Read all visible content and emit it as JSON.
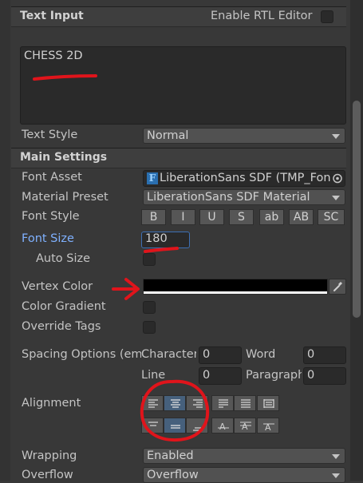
{
  "text_input": {
    "header": "Text Input",
    "rtl_label": "Enable RTL Editor",
    "text_value": "CHESS 2D",
    "text_style_label": "Text Style",
    "text_style_value": "Normal"
  },
  "main_settings": {
    "header": "Main Settings",
    "font_asset_label": "Font Asset",
    "font_asset_value": "LiberationSans SDF (TMP_Fon",
    "material_preset_label": "Material Preset",
    "material_preset_value": "LiberationSans SDF Material",
    "font_style_label": "Font Style",
    "font_style_buttons": [
      "B",
      "I",
      "U",
      "S",
      "ab",
      "AB",
      "SC"
    ],
    "font_size_label": "Font Size",
    "font_size_value": "180",
    "auto_size_label": "Auto Size",
    "vertex_color_label": "Vertex Color",
    "vertex_color": "#000000",
    "color_gradient_label": "Color Gradient",
    "override_tags_label": "Override Tags",
    "spacing_label": "Spacing Options (em)",
    "spacing": {
      "character_label": "Character",
      "character_value": "0",
      "word_label": "Word",
      "word_value": "0",
      "line_label": "Line",
      "line_value": "0",
      "paragraph_label": "Paragraph",
      "paragraph_value": "0"
    },
    "alignment_label": "Alignment",
    "wrapping_label": "Wrapping",
    "wrapping_value": "Enabled",
    "overflow_label": "Overflow",
    "overflow_value": "Overflow"
  },
  "colors": {
    "background": "#383838",
    "accent_blue": "#7fb1ff",
    "selected_button": "#46607c",
    "annotation_red": "#e0141b"
  }
}
